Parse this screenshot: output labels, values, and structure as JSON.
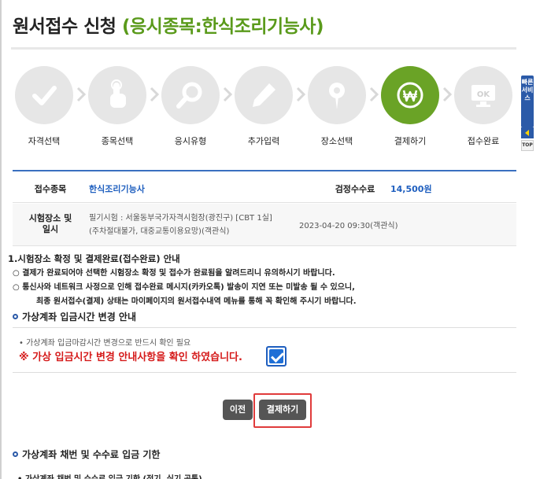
{
  "header": {
    "title_main": "원서접수 신청",
    "title_sub": "(응시종목:한식조리기능사)"
  },
  "steps": [
    {
      "label": "자격선택",
      "icon": "check-icon"
    },
    {
      "label": "종목선택",
      "icon": "pointer-hand-icon"
    },
    {
      "label": "응시유형",
      "icon": "magnifier-icon"
    },
    {
      "label": "추가입력",
      "icon": "pencil-icon"
    },
    {
      "label": "장소선택",
      "icon": "location-pin-icon"
    },
    {
      "label": "결제하기",
      "icon": "won-coin-icon",
      "active": true
    },
    {
      "label": "접수완료",
      "icon": "ok-monitor-icon"
    }
  ],
  "colors": {
    "accent_green": "#6aa326",
    "title_green": "#5a9a1b",
    "link_blue": "#1f5fbf",
    "warning_red": "#d51a1a",
    "side_blue": "#2b5aa8"
  },
  "side": {
    "quick_label": "빠른서비스",
    "top_label": "TOP"
  },
  "info": {
    "subject_label": "접수종목",
    "subject_value": "한식조리기능사",
    "fee_label": "검정수수료",
    "fee_value": "14,500원",
    "place_label_1": "시험장소 및",
    "place_label_2": "일시",
    "place_line_1": "필기시험 : 서울동부국가자격시험장(광진구) [CBT 1실]",
    "place_line_2": "(주차절대불가, 대중교통이용요망)(객관식)",
    "datetime": "2023-04-20 09:30(객관식)"
  },
  "section1": {
    "title": "1.시험장소 확정 및 결제완료(접수완료) 안내",
    "line1": "○ 결제가 완료되어야 선택한 시험장소 확정 및 접수가 완료됨을 알려드리니 유의하시기 바랍니다.",
    "line2": "○ 통신사와 네트워크 사정으로 인해 접수완료 메시지(카카오톡) 발송이 지연 또는 미발송 될 수 있으니,",
    "line3": "최종 원서접수(결제) 상태는 마이페이지의 원서접수내역 메뉴를 통해 꼭 확인해 주시기 바랍니다."
  },
  "section2": {
    "title": "가상계좌 입금시간 변경 안내",
    "small": "• 가상계좌 입금마감시간 변경으로 반드시 확인 필요",
    "confirm": "※ 가상 입금시간 변경 안내사항을 확인 하였습니다."
  },
  "buttons": {
    "prev": "이전",
    "pay": "결제하기"
  },
  "section3": {
    "title": "가상계좌 채번 및 수수료 입금 기한",
    "cut_line": "• 가상계좌 채번 및 수수료 입금 기한 (전기, 실기 공통)"
  }
}
